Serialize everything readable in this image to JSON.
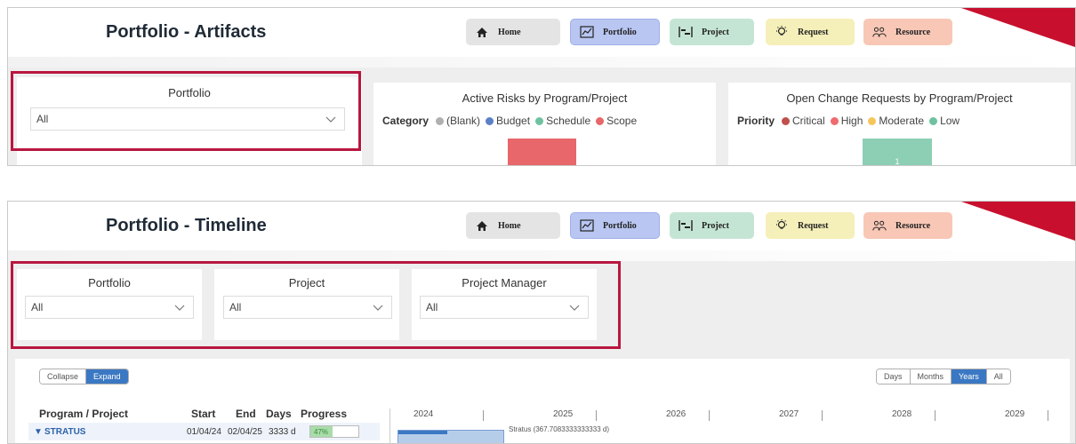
{
  "colors": {
    "accent": "#b8173f",
    "home_bg": "#e4e4e4",
    "portfolio_bg": "#b9c6f2",
    "project_bg": "#c5e5d4",
    "request_bg": "#f5efb9",
    "resource_bg": "#f8c7b6",
    "bar_blue": "#3b78c3"
  },
  "nav": {
    "home": "Home",
    "portfolio": "Portfolio",
    "project": "Project",
    "request": "Request",
    "resource": "Resource"
  },
  "artifacts": {
    "title": "Portfolio - Artifacts",
    "portfolio_filter": {
      "label": "Portfolio",
      "value": "All"
    },
    "risks_card": {
      "title": "Active Risks by Program/Project",
      "legend_title": "Category",
      "legend": [
        {
          "label": "(Blank)",
          "color": "#b0b0b0"
        },
        {
          "label": "Budget",
          "color": "#5b80c8"
        },
        {
          "label": "Schedule",
          "color": "#6fc2a0"
        },
        {
          "label": "Scope",
          "color": "#e8676a"
        }
      ]
    },
    "changes_card": {
      "title": "Open Change Requests by Program/Project",
      "legend_title": "Priority",
      "legend": [
        {
          "label": "Critical",
          "color": "#c0504d"
        },
        {
          "label": "High",
          "color": "#ee6b6e"
        },
        {
          "label": "Moderate",
          "color": "#f5c75a"
        },
        {
          "label": "Low",
          "color": "#6fc2a0"
        }
      ],
      "bar_value": "1"
    }
  },
  "timeline": {
    "title": "Portfolio - Timeline",
    "filters": [
      {
        "label": "Portfolio",
        "value": "All"
      },
      {
        "label": "Project",
        "value": "All"
      },
      {
        "label": "Project Manager",
        "value": "All"
      }
    ],
    "collapse": "Collapse",
    "expand": "Expand",
    "scales": [
      "Days",
      "Months",
      "Years",
      "All"
    ],
    "active_scale": "Years",
    "columns": {
      "program": "Program / Project",
      "start": "Start",
      "end": "End",
      "days": "Days",
      "progress": "Progress"
    },
    "years": [
      "2024",
      "2025",
      "2026",
      "2027",
      "2028",
      "2029"
    ],
    "row": {
      "expand_glyph": "▼",
      "name": "STRATUS",
      "start": "01/04/24",
      "end": "02/04/25",
      "days": "3333 d",
      "progress": "47%",
      "progress_fraction": 0.47,
      "bar_label": "Stratus (367.7083333333333 d)"
    }
  }
}
